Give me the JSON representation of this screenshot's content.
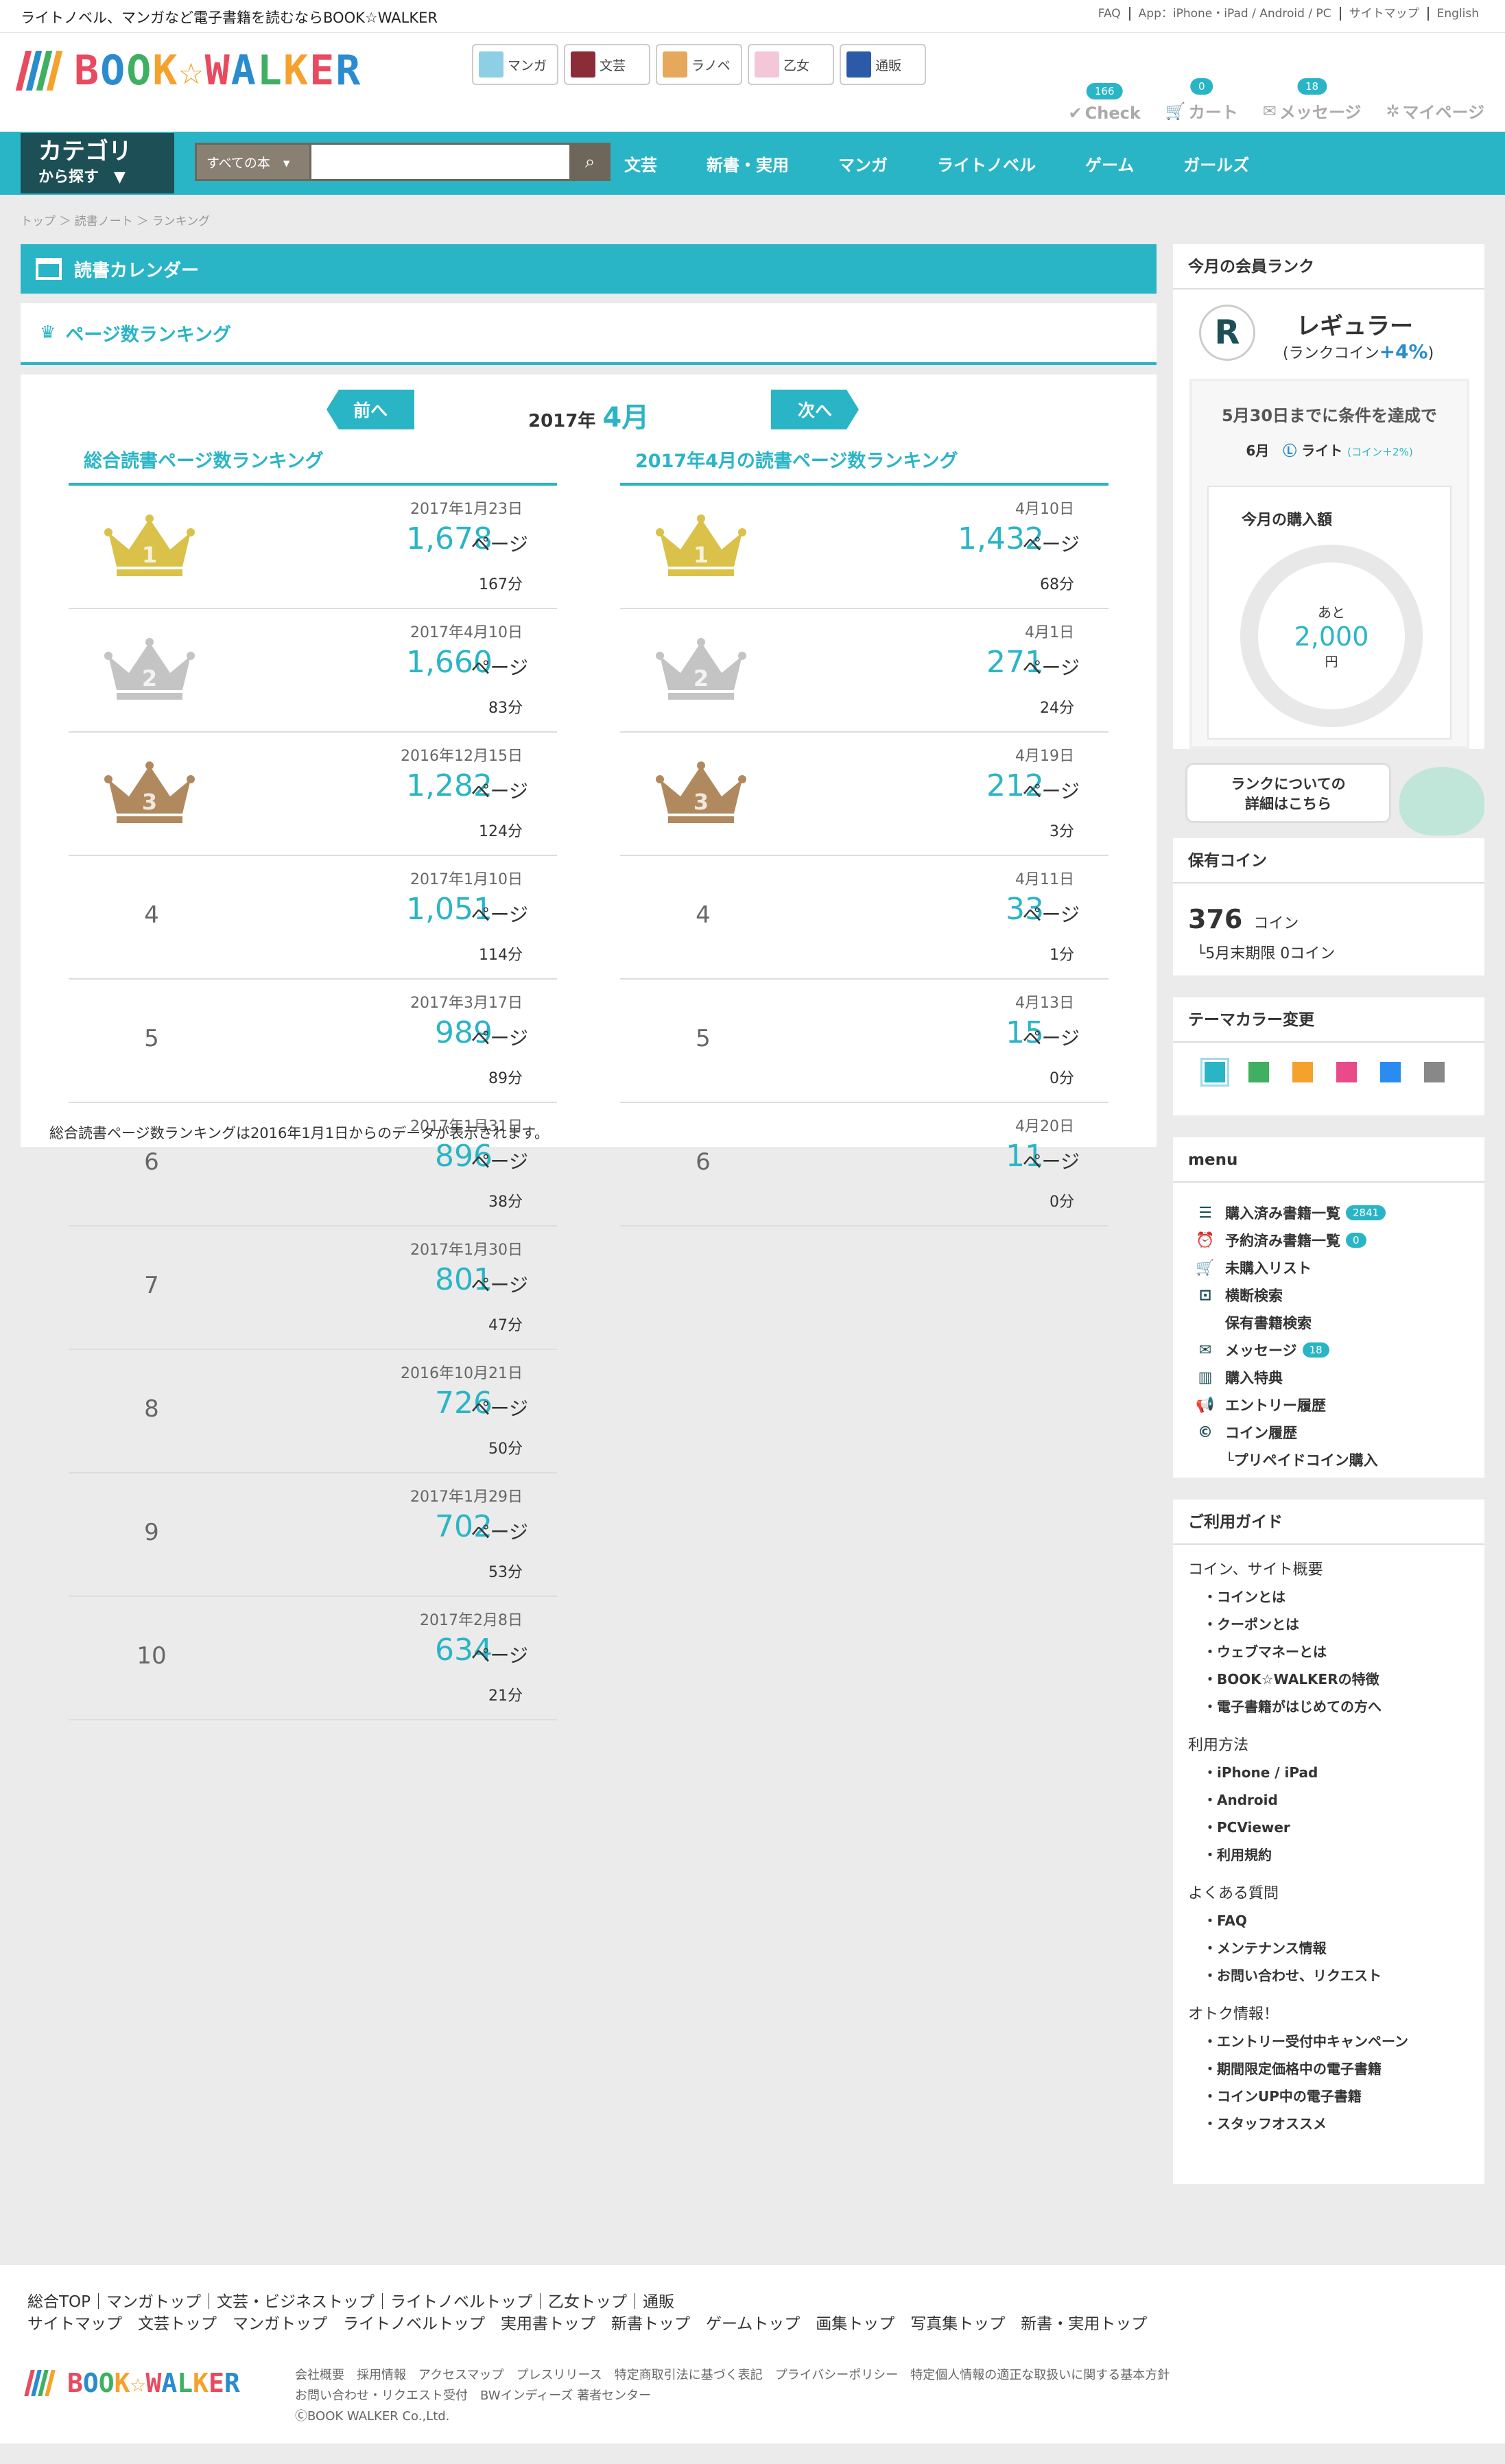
{
  "topbar": {
    "tagline": "ライトノベル、マンガなど電子書籍を読むならBOOK☆WALKER",
    "links": [
      "FAQ",
      "App：iPhone・iPad / Android / PC",
      "サイトマップ",
      "English"
    ]
  },
  "logo": {
    "text": "BOOK☆WALKER",
    "colors": [
      "#e84a5f",
      "#2a8ccf",
      "#3fb062",
      "#f4a22d"
    ]
  },
  "categories": [
    {
      "label": "マンガ",
      "color": "#8ecfe6"
    },
    {
      "label": "文芸",
      "color": "#8b2c36"
    },
    {
      "label": "ラノベ",
      "color": "#e6a85a"
    },
    {
      "label": "乙女",
      "color": "#f3c7d8"
    },
    {
      "label": "通販",
      "color": "#2a5aa8"
    }
  ],
  "usernav": [
    {
      "label": "Check",
      "badge": "166",
      "icon": "✔"
    },
    {
      "label": "カート",
      "badge": "0",
      "icon": "🛒"
    },
    {
      "label": "メッセージ",
      "badge": "18",
      "icon": "✉"
    },
    {
      "label": "マイページ",
      "badge": "",
      "icon": "✲"
    }
  ],
  "nav": {
    "cat_line1": "カテゴリ",
    "cat_line2": "から探す　▼",
    "search_select": "すべての本　▾",
    "search_placeholder": "",
    "items": [
      "文芸",
      "新書・実用",
      "マンガ",
      "ライトノベル",
      "ゲーム",
      "ガールズ"
    ]
  },
  "breadcrumb": "トップ ＞ 読書ノート ＞ ランキング",
  "main": {
    "calendar_title": "読書カレンダー",
    "ranking_title": "ページ数ランキング",
    "prev": "前へ",
    "next": "次へ",
    "year": "2017年",
    "month": "4月",
    "left_title": "総合読書ページ数ランキング",
    "right_title": "2017年4月の読書ページ数ランキング",
    "page_unit": "ページ",
    "note": "総合読書ページ数ランキングは2016年1月1日からのデータが表示されます。"
  },
  "left_rows": [
    {
      "rank": "1",
      "date": "2017年1月23日",
      "pages": "1,678",
      "mins": "167分"
    },
    {
      "rank": "2",
      "date": "2017年4月10日",
      "pages": "1,660",
      "mins": "83分"
    },
    {
      "rank": "3",
      "date": "2016年12月15日",
      "pages": "1,282",
      "mins": "124分"
    },
    {
      "rank": "4",
      "date": "2017年1月10日",
      "pages": "1,051",
      "mins": "114分"
    },
    {
      "rank": "5",
      "date": "2017年3月17日",
      "pages": "989",
      "mins": "89分"
    },
    {
      "rank": "6",
      "date": "2017年1月31日",
      "pages": "896",
      "mins": "38分"
    },
    {
      "rank": "7",
      "date": "2017年1月30日",
      "pages": "801",
      "mins": "47分"
    },
    {
      "rank": "8",
      "date": "2016年10月21日",
      "pages": "726",
      "mins": "50分"
    },
    {
      "rank": "9",
      "date": "2017年1月29日",
      "pages": "702",
      "mins": "53分"
    },
    {
      "rank": "10",
      "date": "2017年2月8日",
      "pages": "634",
      "mins": "21分"
    }
  ],
  "right_rows": [
    {
      "rank": "1",
      "date": "4月10日",
      "pages": "1,432",
      "mins": "68分"
    },
    {
      "rank": "2",
      "date": "4月1日",
      "pages": "271",
      "mins": "24分"
    },
    {
      "rank": "3",
      "date": "4月19日",
      "pages": "212",
      "mins": "3分"
    },
    {
      "rank": "4",
      "date": "4月11日",
      "pages": "33",
      "mins": "1分"
    },
    {
      "rank": "5",
      "date": "4月13日",
      "pages": "15",
      "mins": "0分"
    },
    {
      "rank": "6",
      "date": "4月20日",
      "pages": "11",
      "mins": "0分"
    }
  ],
  "crown_colors": {
    "gold": "#d9c14a",
    "silver": "#c4c4c4",
    "bronze": "#b08a5e"
  },
  "side": {
    "rank_title": "今月の会員ランク",
    "rank_letter": "R",
    "rank_name": "レギュラー",
    "rank_sub_a": "(ランクコイン",
    "rank_sub_b": "+4%",
    "rank_sub_c": ")",
    "cond_title": "5月30日までに条件を達成で",
    "cond_month": "6月",
    "cond_rank": "ライト",
    "cond_coin": "(コイン＋2%)",
    "buy_title": "今月の購入額",
    "remain_label": "あと",
    "remain_value": "2,000",
    "remain_unit": "円",
    "rank_info_1": "ランクについての",
    "rank_info_2": "詳細はこちら",
    "coin_title": "保有コイン",
    "coin_amount": "376",
    "coin_unit": "コイン",
    "coin_expire": "└5月末期限 0コイン",
    "theme_title": "テーマカラー変更",
    "theme_colors": [
      "#2ab5c6",
      "#3fb062",
      "#f4a22d",
      "#e84a8a",
      "#2a8cf0",
      "#888888"
    ],
    "menu_title": "menu",
    "menu": [
      {
        "icon": "☰",
        "label": "購入済み書籍一覧",
        "badge": "2841"
      },
      {
        "icon": "⏰",
        "label": "予約済み書籍一覧",
        "badge": "0"
      },
      {
        "icon": "🛒",
        "label": "未購入リスト",
        "badge": ""
      },
      {
        "icon": "⊡",
        "label": "横断検索",
        "badge": ""
      },
      {
        "icon": "",
        "label": "保有書籍検索",
        "badge": ""
      },
      {
        "icon": "✉",
        "label": "メッセージ",
        "badge": "18"
      },
      {
        "icon": "▥",
        "label": "購入特典",
        "badge": ""
      },
      {
        "icon": "📢",
        "label": "エントリー履歴",
        "badge": ""
      },
      {
        "icon": "©",
        "label": "コイン履歴",
        "badge": ""
      },
      {
        "icon": "",
        "label": "└プリペイドコイン購入",
        "badge": ""
      }
    ],
    "guide_title": "ご利用ガイド",
    "guide": [
      {
        "head": "コイン、サイト概要",
        "items": [
          "・コインとは",
          "・クーポンとは",
          "・ウェブマネーとは",
          "・BOOK☆WALKERの特徴",
          "・電子書籍がはじめての方へ"
        ]
      },
      {
        "head": "利用方法",
        "items": [
          "・iPhone / iPad",
          "・Android",
          "・PCViewer",
          "・利用規約"
        ]
      },
      {
        "head": "よくある質問",
        "items": [
          "・FAQ",
          "・メンテナンス情報",
          "・お問い合わせ、リクエスト"
        ]
      },
      {
        "head": "オトク情報！",
        "items": [
          "・エントリー受付中キャンペーン",
          "・期間限定価格中の電子書籍",
          "・コインUP中の電子書籍",
          "・スタッフオススメ"
        ]
      }
    ]
  },
  "footer": {
    "line1": "総合TOP｜マンガトップ｜文芸・ビジネストップ｜ライトノベルトップ｜乙女トップ｜通販",
    "line2": "サイトマップ　文芸トップ　マンガトップ　ライトノベルトップ　実用書トップ　新書トップ　ゲームトップ　画集トップ　写真集トップ　新書・実用トップ",
    "meta1": "会社概要　採用情報　アクセスマップ　プレスリリース　特定商取引法に基づく表記　プライバシーポリシー　特定個人情報の適正な取扱いに関する基本方針",
    "meta2": "お問い合わせ・リクエスト受付　BWインディーズ 著者センター",
    "copyright": "ⒸBOOK WALKER Co.,Ltd."
  }
}
